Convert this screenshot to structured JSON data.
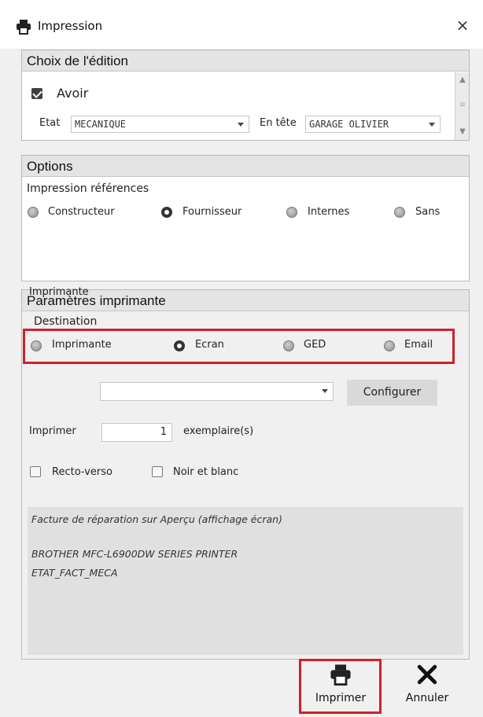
{
  "window": {
    "title": "Impression",
    "close_glyph": "×"
  },
  "edition": {
    "header": "Choix de l'édition",
    "avoir_label": "Avoir",
    "avoir_checked": true,
    "etat_label": "Etat",
    "etat_value": "MECANIQUE",
    "entete_label": "En tête",
    "entete_value": "GARAGE OLIVIER"
  },
  "options": {
    "header": "Options",
    "sublabel": "Impression références",
    "radios": [
      "Constructeur",
      "Fournisseur",
      "Internes",
      "Sans"
    ],
    "selected": "Fournisseur"
  },
  "printer": {
    "header": "Paramètres imprimante",
    "destination_label": "Destination",
    "destinations": [
      "Imprimante",
      "Ecran",
      "GED",
      "Email"
    ],
    "selected_destination": "Ecran",
    "imprimante_label": "Imprimante",
    "imprimante_value": "",
    "configurer_label": "Configurer",
    "imprimer_label": "Imprimer",
    "copies": "1",
    "copies_suffix": "exemplaire(s)",
    "recto_verso_label": "Recto-verso",
    "noir_blanc_label": "Noir et blanc",
    "info_lines": [
      "Facture de réparation sur Aperçu (affichage écran)",
      "BROTHER MFC-L6900DW SERIES PRINTER",
      "ETAT_FACT_MECA"
    ]
  },
  "actions": {
    "print_label": "Imprimer",
    "cancel_label": "Annuler"
  },
  "colors": {
    "highlight": "#d0202a",
    "group_header_bg": "#e4e4e4",
    "panel_bg": "#f0f0f0"
  }
}
